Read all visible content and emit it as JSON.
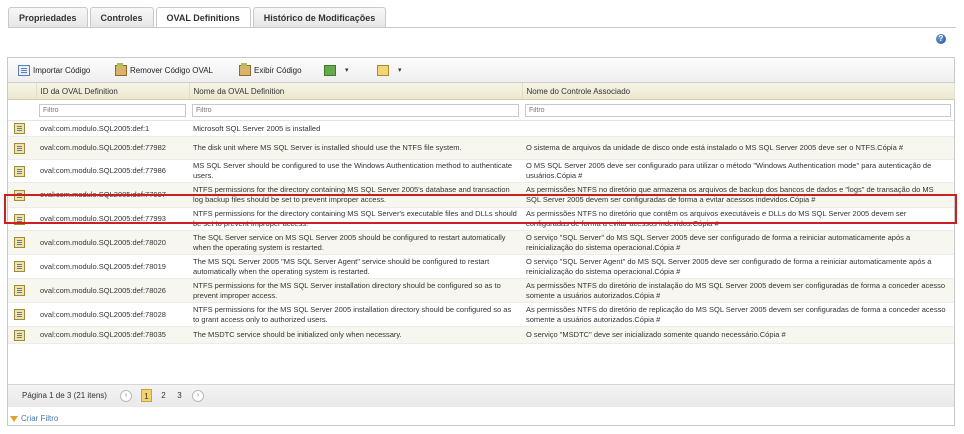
{
  "tabs": [
    {
      "label": "Propriedades",
      "active": false
    },
    {
      "label": "Controles",
      "active": false
    },
    {
      "label": "OVAL Definitions",
      "active": true
    },
    {
      "label": "Histórico de Modificações",
      "active": false
    }
  ],
  "help_label": "?",
  "toolbar": {
    "import_label": "Importar Código",
    "remove_label": "Remover Código OVAL",
    "show_label": "Exibir Código",
    "dropdown_caret": "▾"
  },
  "grid": {
    "columns": [
      "ID da OVAL Definition",
      "Nome da OVAL Definition",
      "Nome do Controle Associado"
    ],
    "filter_placeholder": "Filtro",
    "rows": [
      {
        "id": "oval:com.modulo.SQL2005:def:1",
        "name": "Microsoft SQL Server 2005 is installed",
        "control": ""
      },
      {
        "id": "oval:com.modulo.SQL2005:def:77982",
        "name": "The disk unit where MS SQL Server is installed should use the NTFS file system.",
        "control": "O sistema de arquivos da unidade de disco onde está instalado o MS SQL Server 2005 deve ser o NTFS.Cópia #"
      },
      {
        "id": "oval:com.modulo.SQL2005:def:77986",
        "name": "MS SQL Server should be configured to use the Windows Authentication method to authenticate users.",
        "control": "O MS SQL Server 2005 deve ser configurado para utilizar o método \"Windows Authentication mode\" para autenticação de usuários.Cópia #"
      },
      {
        "id": "oval:com.modulo.SQL2005:def:77997",
        "name": "NTFS permissions for the directory containing MS SQL Server 2005's database and transaction log backup files should be set to prevent improper access.",
        "control": "As permissões NTFS no diretório que armazena os arquivos de backup dos bancos de dados e \"logs\" de transação do MS SQL Server 2005 devem ser configuradas de forma a evitar acessos indevidos.Cópia #",
        "highlighted": true
      },
      {
        "id": "oval:com.modulo.SQL2005:def:77993",
        "name": "NTFS permissions for the directory containing MS SQL Server's executable files and DLLs should be set to prevent improper access.",
        "control": "As permissões NTFS no diretório que contêm os arquivos executáveis e DLLs do MS SQL Server 2005 devem ser configuradas de forma a evitar acessos indevidos.Cópia #"
      },
      {
        "id": "oval:com.modulo.SQL2005:def:78020",
        "name": "The SQL Server service on MS SQL Server 2005 should be configured to restart automatically when the operating system is restarted.",
        "control": "O serviço \"SQL Server\" do MS SQL Server 2005 deve ser configurado de forma a reiniciar automaticamente após a reinicialização do sistema operacional.Cópia #"
      },
      {
        "id": "oval:com.modulo.SQL2005:def:78019",
        "name": "The MS SQL Server 2005 \"MS SQL Server Agent\" service should be configured to restart automatically when the operating system is restarted.",
        "control": "O serviço \"SQL Server Agent\" do MS SQL Server 2005 deve ser configurado de forma a reiniciar automaticamente após a reinicialização do sistema operacional.Cópia #"
      },
      {
        "id": "oval:com.modulo.SQL2005:def:78026",
        "name": "NTFS permissions for the MS SQL Server installation directory should be configured so as to prevent improper access.",
        "control": "As permissões NTFS do diretório de instalação do MS SQL Server 2005 devem ser configuradas de forma a conceder acesso somente a usuários autorizados.Cópia #"
      },
      {
        "id": "oval:com.modulo.SQL2005:def:78028",
        "name": "NTFS permissions for the MS SQL Server 2005 installation directory should be configured so as to grant access only to authorized users.",
        "control": "As permissões NTFS do diretório de replicação do MS SQL Server 2005 devem ser configuradas de forma a conceder acesso somente a usuários autorizados.Cópia #"
      },
      {
        "id": "oval:com.modulo.SQL2005:def:78035",
        "name": "The MSDTC service should be initialized only when necessary.",
        "control": "O serviço \"MSDTC\" deve ser inicializado somente quando necessário.Cópia #"
      }
    ]
  },
  "pager": {
    "info": "Página 1 de 3 (21 itens)",
    "prev": "‹",
    "next": "›",
    "pages": [
      "1",
      "2",
      "3"
    ],
    "current": "1"
  },
  "create_filter_label": "Criar Filtro",
  "colors": {
    "highlight": "#cc1f1f",
    "current_page": "#f5d36c",
    "link": "#4a78b8"
  }
}
